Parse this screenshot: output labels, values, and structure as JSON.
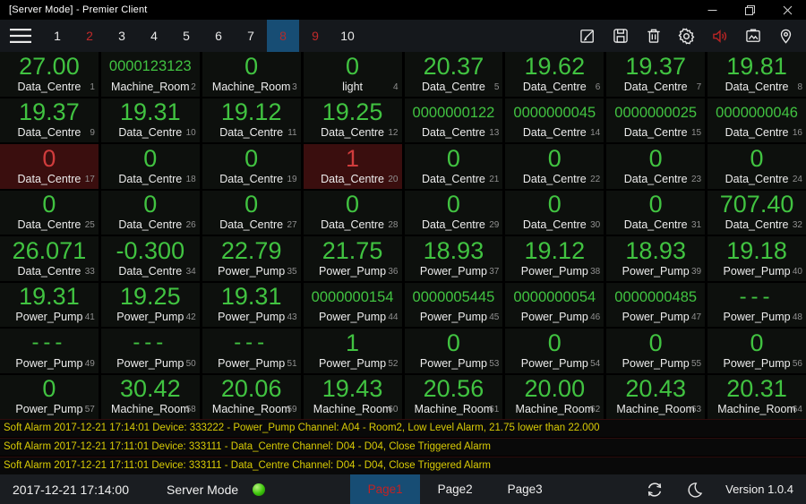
{
  "window": {
    "title": "[Server Mode] - Premier Client",
    "control_icons": [
      "minimize-icon",
      "restore-icon",
      "close-icon"
    ]
  },
  "nav": {
    "menu_icon": "hamburger-icon",
    "pages": [
      {
        "label": "1",
        "state": "normal"
      },
      {
        "label": "2",
        "state": "alert"
      },
      {
        "label": "3",
        "state": "normal"
      },
      {
        "label": "4",
        "state": "normal"
      },
      {
        "label": "5",
        "state": "normal"
      },
      {
        "label": "6",
        "state": "normal"
      },
      {
        "label": "7",
        "state": "normal"
      },
      {
        "label": "8",
        "state": "active"
      },
      {
        "label": "9",
        "state": "alert"
      },
      {
        "label": "10",
        "state": "normal"
      }
    ],
    "toolbar_icons": [
      "edit-icon",
      "save-icon",
      "trash-icon",
      "gear-icon",
      "speaker-icon",
      "snapshot-icon",
      "location-icon"
    ],
    "speaker_color": "#b32424"
  },
  "grid": {
    "cells": [
      {
        "value": "27.00",
        "label": "Data_Centre",
        "index": 1,
        "alarm": false
      },
      {
        "value": "0000123123",
        "label": "Machine_Room",
        "index": 2,
        "alarm": false
      },
      {
        "value": "0",
        "label": "Machine_Room",
        "index": 3,
        "alarm": false
      },
      {
        "value": "0",
        "label": "light",
        "index": 4,
        "alarm": false
      },
      {
        "value": "20.37",
        "label": "Data_Centre",
        "index": 5,
        "alarm": false
      },
      {
        "value": "19.62",
        "label": "Data_Centre",
        "index": 6,
        "alarm": false
      },
      {
        "value": "19.37",
        "label": "Data_Centre",
        "index": 7,
        "alarm": false
      },
      {
        "value": "19.81",
        "label": "Data_Centre",
        "index": 8,
        "alarm": false
      },
      {
        "value": "19.37",
        "label": "Data_Centre",
        "index": 9,
        "alarm": false
      },
      {
        "value": "19.31",
        "label": "Data_Centre",
        "index": 10,
        "alarm": false
      },
      {
        "value": "19.12",
        "label": "Data_Centre",
        "index": 11,
        "alarm": false
      },
      {
        "value": "19.25",
        "label": "Data_Centre",
        "index": 12,
        "alarm": false
      },
      {
        "value": "0000000122",
        "label": "Data_Centre",
        "index": 13,
        "alarm": false
      },
      {
        "value": "0000000045",
        "label": "Data_Centre",
        "index": 14,
        "alarm": false
      },
      {
        "value": "0000000025",
        "label": "Data_Centre",
        "index": 15,
        "alarm": false
      },
      {
        "value": "0000000046",
        "label": "Data_Centre",
        "index": 16,
        "alarm": false
      },
      {
        "value": "0",
        "label": "Data_Centre",
        "index": 17,
        "alarm": true
      },
      {
        "value": "0",
        "label": "Data_Centre",
        "index": 18,
        "alarm": false
      },
      {
        "value": "0",
        "label": "Data_Centre",
        "index": 19,
        "alarm": false
      },
      {
        "value": "1",
        "label": "Data_Centre",
        "index": 20,
        "alarm": true
      },
      {
        "value": "0",
        "label": "Data_Centre",
        "index": 21,
        "alarm": false
      },
      {
        "value": "0",
        "label": "Data_Centre",
        "index": 22,
        "alarm": false
      },
      {
        "value": "0",
        "label": "Data_Centre",
        "index": 23,
        "alarm": false
      },
      {
        "value": "0",
        "label": "Data_Centre",
        "index": 24,
        "alarm": false
      },
      {
        "value": "0",
        "label": "Data_Centre",
        "index": 25,
        "alarm": false
      },
      {
        "value": "0",
        "label": "Data_Centre",
        "index": 26,
        "alarm": false
      },
      {
        "value": "0",
        "label": "Data_Centre",
        "index": 27,
        "alarm": false
      },
      {
        "value": "0",
        "label": "Data_Centre",
        "index": 28,
        "alarm": false
      },
      {
        "value": "0",
        "label": "Data_Centre",
        "index": 29,
        "alarm": false
      },
      {
        "value": "0",
        "label": "Data_Centre",
        "index": 30,
        "alarm": false
      },
      {
        "value": "0",
        "label": "Data_Centre",
        "index": 31,
        "alarm": false
      },
      {
        "value": "707.40",
        "label": "Data_Centre",
        "index": 32,
        "alarm": false
      },
      {
        "value": "26.071",
        "label": "Data_Centre",
        "index": 33,
        "alarm": false
      },
      {
        "value": "-0.300",
        "label": "Data_Centre",
        "index": 34,
        "alarm": false
      },
      {
        "value": "22.79",
        "label": "Power_Pump",
        "index": 35,
        "alarm": false
      },
      {
        "value": "21.75",
        "label": "Power_Pump",
        "index": 36,
        "alarm": false
      },
      {
        "value": "18.93",
        "label": "Power_Pump",
        "index": 37,
        "alarm": false
      },
      {
        "value": "19.12",
        "label": "Power_Pump",
        "index": 38,
        "alarm": false
      },
      {
        "value": "18.93",
        "label": "Power_Pump",
        "index": 39,
        "alarm": false
      },
      {
        "value": "19.18",
        "label": "Power_Pump",
        "index": 40,
        "alarm": false
      },
      {
        "value": "19.31",
        "label": "Power_Pump",
        "index": 41,
        "alarm": false
      },
      {
        "value": "19.25",
        "label": "Power_Pump",
        "index": 42,
        "alarm": false
      },
      {
        "value": "19.31",
        "label": "Power_Pump",
        "index": 43,
        "alarm": false
      },
      {
        "value": "0000000154",
        "label": "Power_Pump",
        "index": 44,
        "alarm": false
      },
      {
        "value": "0000005445",
        "label": "Power_Pump",
        "index": 45,
        "alarm": false
      },
      {
        "value": "0000000054",
        "label": "Power_Pump",
        "index": 46,
        "alarm": false
      },
      {
        "value": "0000000485",
        "label": "Power_Pump",
        "index": 47,
        "alarm": false
      },
      {
        "value": "---",
        "label": "Power_Pump",
        "index": 48,
        "alarm": false
      },
      {
        "value": "---",
        "label": "Power_Pump",
        "index": 49,
        "alarm": false
      },
      {
        "value": "---",
        "label": "Power_Pump",
        "index": 50,
        "alarm": false
      },
      {
        "value": "---",
        "label": "Power_Pump",
        "index": 51,
        "alarm": false
      },
      {
        "value": "1",
        "label": "Power_Pump",
        "index": 52,
        "alarm": false
      },
      {
        "value": "0",
        "label": "Power_Pump",
        "index": 53,
        "alarm": false
      },
      {
        "value": "0",
        "label": "Power_Pump",
        "index": 54,
        "alarm": false
      },
      {
        "value": "0",
        "label": "Power_Pump",
        "index": 55,
        "alarm": false
      },
      {
        "value": "0",
        "label": "Power_Pump",
        "index": 56,
        "alarm": false
      },
      {
        "value": "0",
        "label": "Power_Pump",
        "index": 57,
        "alarm": false
      },
      {
        "value": "30.42",
        "label": "Machine_Room",
        "index": 58,
        "alarm": false
      },
      {
        "value": "20.06",
        "label": "Machine_Room",
        "index": 59,
        "alarm": false
      },
      {
        "value": "19.43",
        "label": "Machine_Room",
        "index": 60,
        "alarm": false
      },
      {
        "value": "20.56",
        "label": "Machine_Room",
        "index": 61,
        "alarm": false
      },
      {
        "value": "20.00",
        "label": "Machine_Room",
        "index": 62,
        "alarm": false
      },
      {
        "value": "20.43",
        "label": "Machine_Room",
        "index": 63,
        "alarm": false
      },
      {
        "value": "20.31",
        "label": "Machine_Room",
        "index": 64,
        "alarm": false
      }
    ]
  },
  "alarms": [
    {
      "text": "Soft Alarm 2017-12-21 17:14:01 Device: 333222 - Power_Pump Channel: A04 - Room2, Low Level Alarm, 21.75 lower than 22.000"
    },
    {
      "text": "Soft Alarm 2017-12-21 17:11:01 Device: 333111 - Data_Centre Channel: D04 - D04, Close Triggered Alarm"
    },
    {
      "text": "Soft Alarm 2017-12-21 17:11:01 Device: 333111 - Data_Centre Channel: D04 - D04, Close Triggered Alarm"
    }
  ],
  "statusbar": {
    "clock": "2017-12-21 17:14:00",
    "mode_label": "Server Mode",
    "status_color": "#3cc50a",
    "pages": [
      {
        "label": "Page1",
        "active": true
      },
      {
        "label": "Page2",
        "active": false
      },
      {
        "label": "Page3",
        "active": false
      }
    ],
    "icons": [
      "sync-icon",
      "moon-icon"
    ],
    "version": "Version 1.0.4"
  },
  "colors": {
    "value_green": "#41c341",
    "alarm_red": "#d03c3c",
    "alarm_cell_bg": "#3a0e0e",
    "accent_blue": "#174d74",
    "alarm_text_yellow": "#d9cc06",
    "nav_alert_red": "#c12a2a"
  }
}
